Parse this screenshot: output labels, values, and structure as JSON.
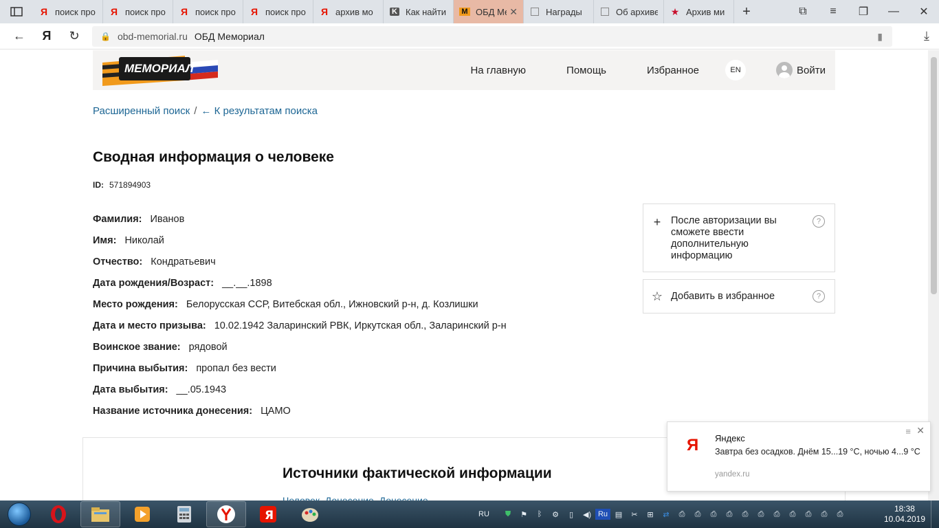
{
  "browser": {
    "tabs": [
      {
        "title": "поиск про",
        "icon": "yandex-icon",
        "active": false
      },
      {
        "title": "поиск про",
        "icon": "yandex-icon",
        "active": false
      },
      {
        "title": "поиск про",
        "icon": "yandex-icon",
        "active": false
      },
      {
        "title": "поиск про",
        "icon": "yandex-icon",
        "active": false
      },
      {
        "title": "архив мо",
        "icon": "yandex-icon",
        "active": false
      },
      {
        "title": "Как найти",
        "icon": "k-icon",
        "active": false
      },
      {
        "title": "ОБД Ме",
        "icon": "memorial-icon",
        "active": true
      },
      {
        "title": "Награды",
        "icon": "page-icon",
        "active": false
      },
      {
        "title": "Об архиве",
        "icon": "page-icon",
        "active": false
      },
      {
        "title": "Архив ми",
        "icon": "star-icon",
        "active": false
      }
    ],
    "new_tab": "+",
    "address": {
      "domain": "obd-memorial.ru",
      "page_title": "ОБД Мемориал"
    }
  },
  "site": {
    "logo_text": "МЕМОРИАЛ",
    "menu": {
      "home": "На главную",
      "help": "Помощь",
      "favorites": "Избранное",
      "lang": "EN",
      "login": "Войти"
    },
    "breadcrumbs": {
      "advanced_search": "Расширенный поиск",
      "separator": "/",
      "back_to_results": "← К результатам поиска"
    }
  },
  "person": {
    "heading": "Сводная информация о человеке",
    "id_label": "ID:",
    "id_value": "571894903",
    "fields": [
      {
        "label": "Фамилия:",
        "value": "Иванов"
      },
      {
        "label": "Имя:",
        "value": "Николай"
      },
      {
        "label": "Отчество:",
        "value": "Кондратьевич"
      },
      {
        "label": "Дата рождения/Возраст:",
        "value": "__.__.1898"
      },
      {
        "label": "Место рождения:",
        "value": "Белорусская ССР, Витебская обл., Ижновский р-н, д. Козлишки"
      },
      {
        "label": "Дата и место призыва:",
        "value": "10.02.1942 Заларинский РВК, Иркутская обл., Заларинский р-н"
      },
      {
        "label": "Воинское звание:",
        "value": "рядовой"
      },
      {
        "label": "Причина выбытия:",
        "value": "пропал без вести"
      },
      {
        "label": "Дата выбытия:",
        "value": "__.05.1943"
      },
      {
        "label": "Название источника донесения:",
        "value": "ЦАМО"
      }
    ]
  },
  "sidebar": {
    "auth_note": "После авторизации вы сможете ввести дополнительную информацию",
    "add_favorite": "Добавить в избранное",
    "help_mark": "?"
  },
  "sources": {
    "heading": "Источники фактической информации",
    "link": "Человек. Донесение. Донесение"
  },
  "notification": {
    "logo": "Я",
    "title": "Яндекс",
    "body": "Завтра без осадков. Днём 15...19 °С, ночью 4...9 °С",
    "source": "yandex.ru"
  },
  "taskbar": {
    "lang": "RU",
    "ime": "Ru",
    "time": "18:38",
    "date": "10.04.2019"
  }
}
